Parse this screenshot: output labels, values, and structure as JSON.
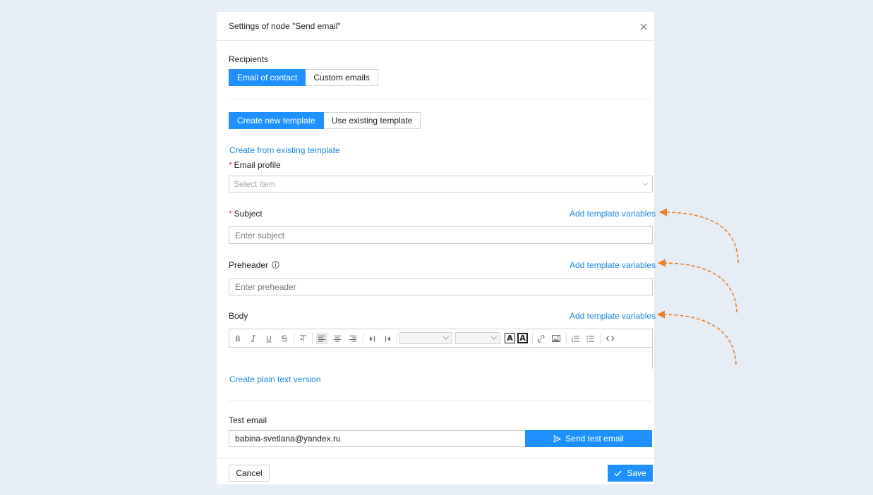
{
  "dialog": {
    "title": "Settings of node \"Send email\"",
    "close_icon": "close-icon"
  },
  "recipients": {
    "label": "Recipients",
    "options": [
      "Email of contact",
      "Custom emails"
    ],
    "active": "Email of contact"
  },
  "template_mode": {
    "options": [
      "Create new template",
      "Use existing template"
    ],
    "active": "Create new template"
  },
  "create_from_existing_link": "Create from existing template",
  "email_profile": {
    "label": "Email profile",
    "required": "*",
    "placeholder": "Select item"
  },
  "subject": {
    "label": "Subject",
    "required": "*",
    "placeholder": "Enter subject",
    "add_variables": "Add template variables"
  },
  "preheader": {
    "label": "Preheader",
    "placeholder": "Enter preheader",
    "add_variables": "Add template variables",
    "info_icon": "info-icon"
  },
  "body": {
    "label": "Body",
    "add_variables": "Add template variables",
    "toolbar_letter": "A",
    "toolbar_icons": [
      "bold-icon",
      "italic-icon",
      "underline-icon",
      "strikethrough-icon",
      "clear-format-icon",
      "align-left-icon",
      "align-center-icon",
      "align-right-icon",
      "indent-icon",
      "outdent-icon",
      "font-family-select",
      "font-size-select",
      "text-color-icon",
      "background-color-icon",
      "link-icon",
      "image-icon",
      "ordered-list-icon",
      "unordered-list-icon",
      "code-view-icon"
    ]
  },
  "plain_text_link": "Create plain text version",
  "test_email": {
    "label": "Test email",
    "value": "babina-svetlana@yandex.ru",
    "send_label": "Send test email",
    "send_icon": "send-icon"
  },
  "footer": {
    "cancel_label": "Cancel",
    "save_label": "Save",
    "save_icon": "check-icon"
  },
  "colors": {
    "primary": "#1e90ff",
    "link": "#1e86e0",
    "required": "#e5322b",
    "annotation_arrow": "#e8802a",
    "background": "#e6edf5"
  }
}
